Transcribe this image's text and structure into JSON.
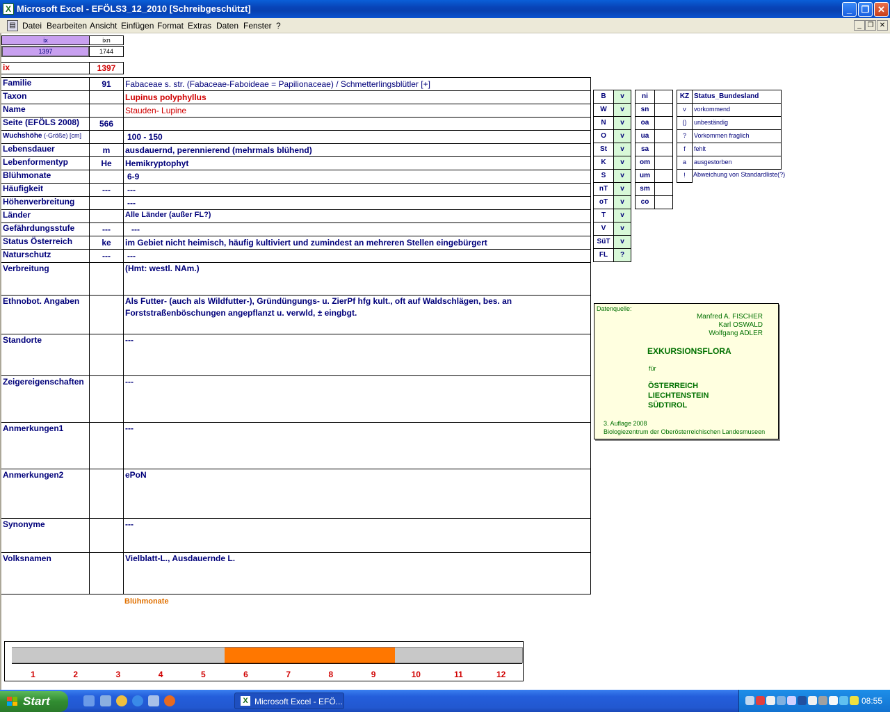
{
  "window": {
    "title": "Microsoft Excel - EFÖLS3_12_2010  [Schreibgeschützt]"
  },
  "menu": [
    "Datei",
    "Bearbeiten",
    "Ansicht",
    "Einfügen",
    "Format",
    "Extras",
    "Daten",
    "Fenster",
    "?"
  ],
  "index_header": {
    "col1": "ix",
    "col2": "ixn",
    "val1": "1397",
    "val2": "1744"
  },
  "ix": {
    "label": "ix",
    "value": "1397"
  },
  "rows": [
    {
      "label": "Familie",
      "code": "91",
      "value": "Fabaceae s. str. (Fabaceae-Faboideae = Papilionaceae)  /  Schmetterlingsblütler [+]"
    },
    {
      "label": "Taxon",
      "code": "",
      "value": "Lupinus polyphyllus"
    },
    {
      "label": "Name",
      "code": "",
      "value": "Stauden- Lupine"
    },
    {
      "label": "Seite (EFÖLS 2008)",
      "code": "566",
      "value": ""
    },
    {
      "label": "Wuchshöhe",
      "label_suffix": " (-Größe) [cm]",
      "code": "",
      "value": "100 - 150"
    },
    {
      "label": "Lebensdauer",
      "code": "m",
      "value": "ausdauernd, perennierend (mehrmals blühend)"
    },
    {
      "label": "Lebenformentyp",
      "code": "He",
      "value": "Hemikryptophyt"
    },
    {
      "label": "Blühmonate",
      "code": "",
      "value": "6-9"
    },
    {
      "label": "Häufigkeit",
      "code": "---",
      "value": "---"
    },
    {
      "label": "Höhenverbreitung",
      "code": "",
      "value": "---"
    },
    {
      "label": "Länder",
      "code": "",
      "value": "Alle Länder (außer FL?)"
    },
    {
      "label": "Gefährdungsstufe",
      "code": "---",
      "value": "---"
    },
    {
      "label": "Status Österreich",
      "code": "ke",
      "value": "im Gebiet nicht heimisch, häufig kultiviert und zumindest an mehreren Stellen eingebürgert"
    },
    {
      "label": "Naturschutz",
      "code": "---",
      "value": "---"
    }
  ],
  "tall_rows": [
    {
      "label": "Verbreitung",
      "value": "(Hmt: westl. NAm.)"
    },
    {
      "label": "Ethnobot. Angaben",
      "value": "Als Futter- (auch als Wildfutter-), Gründüngungs- u. ZierPf hfg kult., oft auf Waldschlägen, bes. an",
      "value2": "Forststraßenböschungen angepflanzt u. verwld, ± eingbgt."
    },
    {
      "label": "Standorte",
      "value": "---"
    },
    {
      "label": "Zeigereigenschaften",
      "value": "---"
    },
    {
      "label": "Anmerkungen1",
      "value": "---"
    },
    {
      "label": "Anmerkungen2",
      "value": "ePoN"
    },
    {
      "label": "Synonyme",
      "value": "---"
    },
    {
      "label": "Volksnamen",
      "value": "Vielblatt-L., Ausdauernde L."
    }
  ],
  "bundesland": [
    {
      "k": "B",
      "v": "v"
    },
    {
      "k": "W",
      "v": "v"
    },
    {
      "k": "N",
      "v": "v"
    },
    {
      "k": "O",
      "v": "v"
    },
    {
      "k": "St",
      "v": "v"
    },
    {
      "k": "K",
      "v": "v"
    },
    {
      "k": "S",
      "v": "v"
    },
    {
      "k": "nT",
      "v": "v"
    },
    {
      "k": "oT",
      "v": "v"
    },
    {
      "k": "T",
      "v": "v"
    },
    {
      "k": "V",
      "v": "v"
    },
    {
      "k": "SüT",
      "v": "v"
    },
    {
      "k": "FL",
      "v": "?"
    }
  ],
  "regions": [
    "ni",
    "sn",
    "oa",
    "ua",
    "sa",
    "om",
    "um",
    "sm",
    "co"
  ],
  "legend": {
    "kz_header": "KZ",
    "status_header": "Status_Bundesland",
    "items": [
      {
        "k": "v",
        "t": "vorkommend"
      },
      {
        "k": "()",
        "t": "unbeständig"
      },
      {
        "k": "?",
        "t": "Vorkommen fraglich"
      },
      {
        "k": "f",
        "t": "fehlt"
      },
      {
        "k": "a",
        "t": "ausgestorben"
      },
      {
        "k": "!",
        "t": "Abweichung von Standardliste(?)"
      }
    ]
  },
  "datenquelle": {
    "label": "Datenquelle:",
    "authors": [
      "Manfred A. FISCHER",
      "Karl OSWALD",
      "Wolfgang ADLER"
    ],
    "title": "EXKURSIONSFLORA",
    "fuer": "für",
    "countries": [
      "ÖSTERREICH",
      "LIECHTENSTEIN",
      "SÜDTIROL"
    ],
    "edition": "3. Auflage 2008",
    "publisher": "Biologiezentrum der Oberösterreichischen Landesmuseen"
  },
  "chart_data": {
    "type": "bar",
    "title": "Blühmonate",
    "categories": [
      "1",
      "2",
      "3",
      "4",
      "5",
      "6",
      "7",
      "8",
      "9",
      "10",
      "11",
      "12"
    ],
    "values": [
      0,
      0,
      0,
      0,
      0,
      1,
      1,
      1,
      1,
      0,
      0,
      0
    ],
    "colors": {
      "on": "#ff7700",
      "off": "#c8c8c8"
    }
  },
  "taskbar": {
    "start": "Start",
    "task": "Microsoft Excel - EFÖ...",
    "clock": "08:55"
  }
}
